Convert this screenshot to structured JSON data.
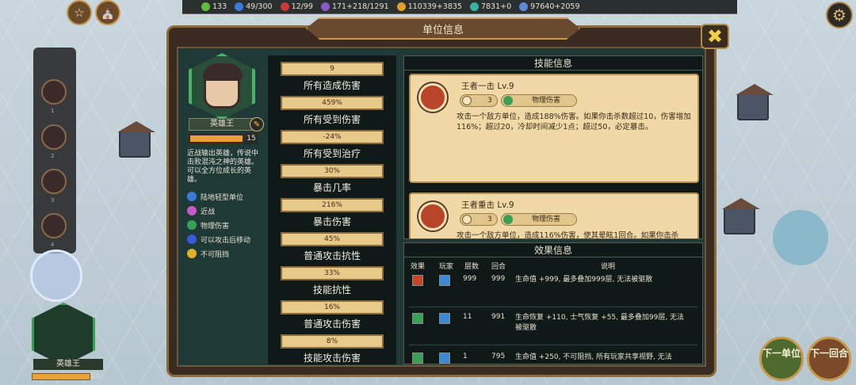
{
  "resources": [
    {
      "icon": "leaf-icon",
      "value": "133",
      "color": "#5fbf3a"
    },
    {
      "icon": "population-icon",
      "value": "49/300",
      "color": "#3a7ad8"
    },
    {
      "icon": "wrench-icon",
      "value": "12/99",
      "color": "#c83a3a"
    },
    {
      "icon": "faith-icon",
      "value": "171+218/1291",
      "color": "#8a5ac8"
    },
    {
      "icon": "gold-icon",
      "value": "110339+3835",
      "color": "#e0a02a"
    },
    {
      "icon": "culture-icon",
      "value": "7831+0",
      "color": "#3ab0a0"
    },
    {
      "icon": "science-icon",
      "value": "97640+2059",
      "color": "#5a8ad8"
    }
  ],
  "panel_title": "单位信息",
  "hero": {
    "name": "英雄王",
    "level": "15",
    "description": "近战输出英雄，传说中击败混沌之神的英雄。可以全方位成长的英雄。",
    "traits": [
      {
        "icon": "infantry-icon",
        "label": "陆地轻型单位",
        "color": "#3a7ad8"
      },
      {
        "icon": "melee-icon",
        "label": "近战",
        "color": "#c85ac8"
      },
      {
        "icon": "physical-icon",
        "label": "物理伤害",
        "color": "#3aa055"
      },
      {
        "icon": "move-after-attack-icon",
        "label": "可以攻击后移动",
        "color": "#3a5ad8"
      },
      {
        "icon": "unstoppable-icon",
        "label": "不可阻挡",
        "color": "#e0b02a"
      }
    ]
  },
  "stats": [
    {
      "value": "9",
      "name": "所有造成伤害"
    },
    {
      "value": "459%",
      "name": "所有受到伤害"
    },
    {
      "value": "-24%",
      "name": "所有受到治疗"
    },
    {
      "value": "30%",
      "name": "暴击几率"
    },
    {
      "value": "216%",
      "name": "暴击伤害"
    },
    {
      "value": "45%",
      "name": "普通攻击抗性"
    },
    {
      "value": "33%",
      "name": "技能抗性"
    },
    {
      "value": "16%",
      "name": "普通攻击伤害"
    },
    {
      "value": "8%",
      "name": "技能攻击伤害"
    }
  ],
  "skills_header": "技能信息",
  "skills": [
    {
      "title": "王者一击 Lv.9",
      "cooldown": "3",
      "type": "物理伤害",
      "icon": "slash-icon",
      "desc": "攻击一个敌方单位，造成188%伤害。如果你击杀数超过10，伤害增加116%；超过20，冷却时间减少1点；超过50，必定暴击。"
    },
    {
      "title": "王者重击 Lv.9",
      "cooldown": "3",
      "type": "物理伤害",
      "icon": "claw-icon",
      "desc": "攻击一个敌方单位，造成116%伤害，使其晕眩1回合。如果你击杀"
    }
  ],
  "effects_header": "效果信息",
  "effects_columns": {
    "effect": "效果",
    "player": "玩家",
    "stacks": "层数",
    "turns": "回合",
    "desc": "说明"
  },
  "effects": [
    {
      "icon": "fortress-icon",
      "icon_color": "#c8452a",
      "stacks": "999",
      "turns": "999",
      "desc": "生命值 +999, 最多叠加999层, 无法被驱散"
    },
    {
      "icon": "regen-icon",
      "icon_color": "#3aa055",
      "stacks": "11",
      "turns": "991",
      "desc": "生命恢复 +110, 士气恢复 +55, 最多叠加99层, 无法被驱散"
    },
    {
      "icon": "shield-icon",
      "icon_color": "#3aa055",
      "stacks": "1",
      "turns": "795",
      "desc": "生命值 +250, 不可阻挡, 所有玩家共享视野, 无法"
    }
  ],
  "bottom_unit": {
    "name": "英雄王",
    "level": "15"
  },
  "buttons": {
    "next_unit": "下一单位",
    "next_turn": "下一回合"
  }
}
